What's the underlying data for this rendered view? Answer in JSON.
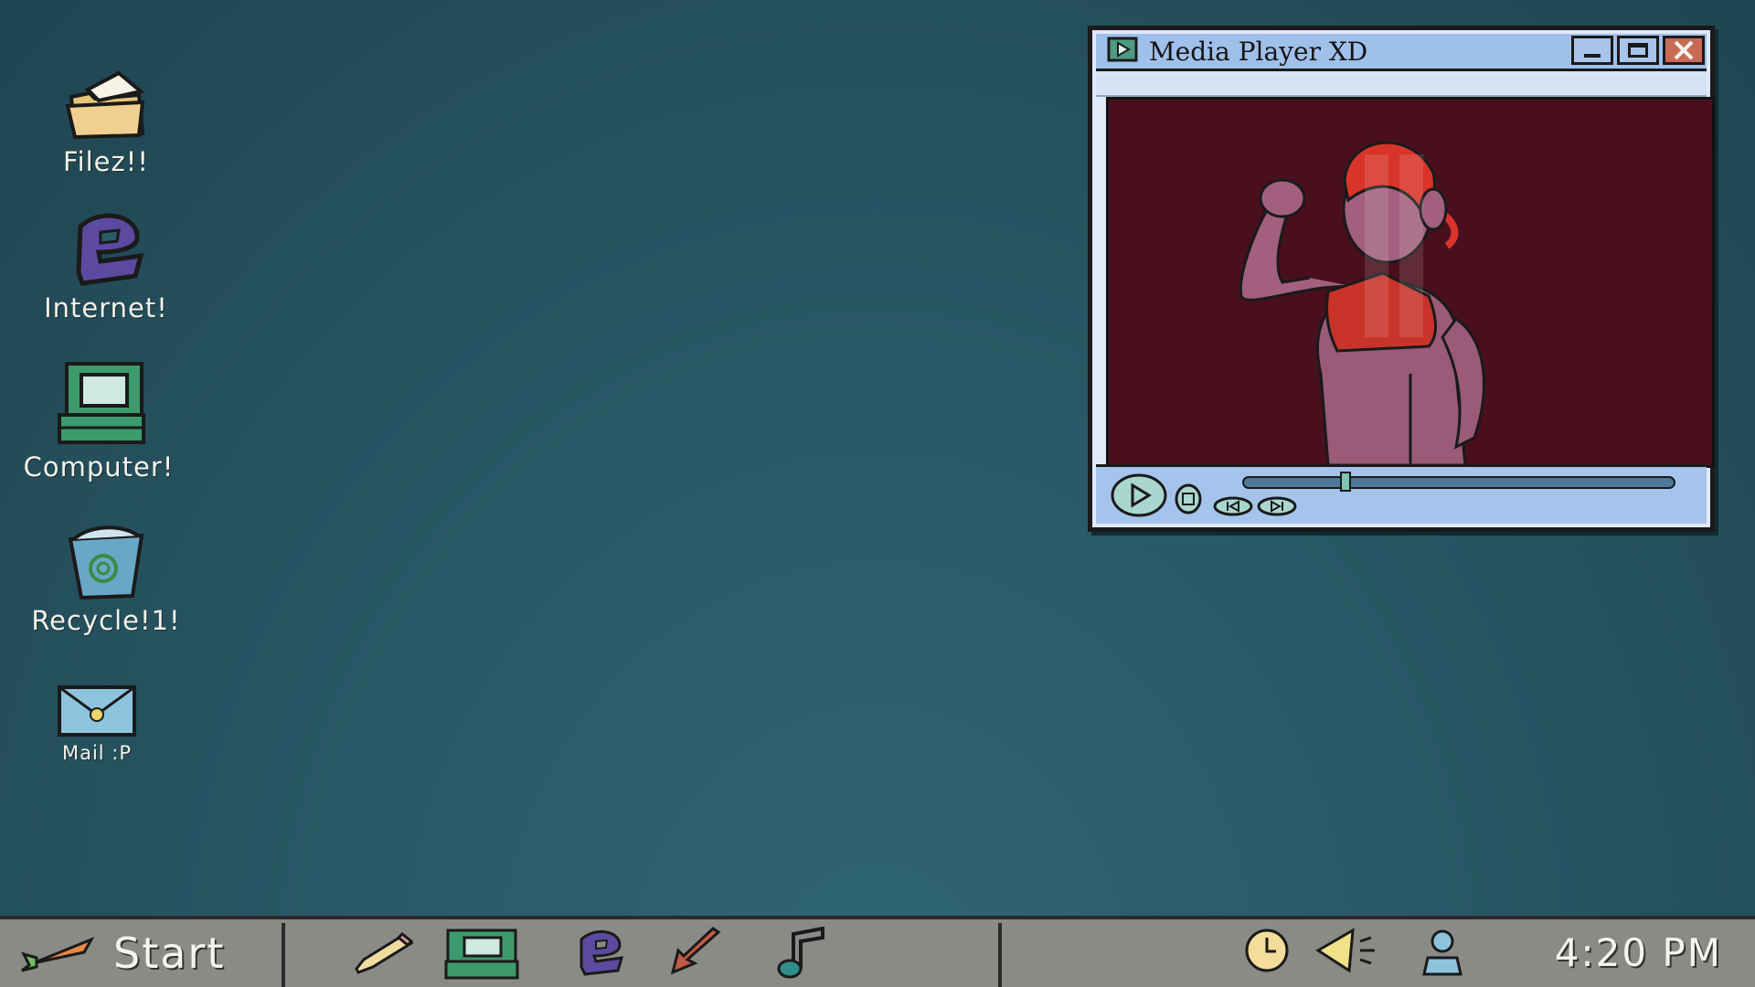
{
  "desktop": {
    "icons": [
      {
        "label": "Filez!!",
        "icon": "folder-icon"
      },
      {
        "label": "Internet!",
        "icon": "internet-icon"
      },
      {
        "label": "Computer!",
        "icon": "computer-icon"
      },
      {
        "label": "Recycle!1!",
        "icon": "recycle-bin-icon"
      },
      {
        "label": "Mail :P",
        "icon": "mail-icon"
      }
    ]
  },
  "window": {
    "title": "Media Player XD",
    "title_icon": "media-player-icon",
    "buttons": {
      "minimize": "minimize-icon",
      "maximize": "maximize-icon",
      "close": "close-icon"
    },
    "controls": {
      "play": "play-icon",
      "stop": "stop-icon",
      "previous": "previous-icon",
      "next": "next-icon",
      "seek_progress": 0.23
    },
    "video_description_icon": "video-frame"
  },
  "taskbar": {
    "start_label": "Start",
    "start_icon": "carrot-icon",
    "pinned": [
      "pencil-icon",
      "computer-icon",
      "internet-icon",
      "arrow-icon",
      "music-note-icon"
    ],
    "tray": [
      "clock-icon",
      "volume-icon",
      "user-icon"
    ],
    "time": "4:20 PM"
  },
  "colors": {
    "desktop": "#2a5a68",
    "window_title": "#9fc0ea",
    "video_bg": "#4a0f1e",
    "taskbar": "#8a8a87",
    "close_button": "#c86b55"
  }
}
